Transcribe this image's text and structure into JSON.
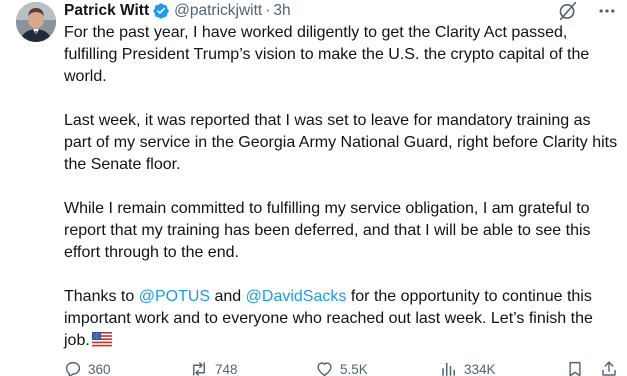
{
  "tweet": {
    "author": {
      "display_name": "Patrick Witt",
      "handle": "@patrickjwitt",
      "separator": "·",
      "time": "3h",
      "verified_color": "#1d9bf0"
    },
    "body": {
      "p1": "For the past year, I have worked diligently to get the Clarity Act passed, fulfilling President Trump’s vision to make the U.S. the crypto capital of the world.",
      "p2": "Last week, it was reported that I was set to leave for mandatory training as part of my service in the Georgia Army National Guard, right before Clarity hits the Senate floor.",
      "p3": "While I remain committed to fulfilling my service obligation, I am grateful to report that my training has been deferred, and that I will be able to see this effort through to the end.",
      "p4_prefix": "Thanks to ",
      "p4_mention1": "@POTUS",
      "p4_middle": " and ",
      "p4_mention2": "@DavidSacks",
      "p4_suffix": " for the opportunity to continue this important work and to everyone who reached out last week. Let’s finish the job."
    },
    "stats": {
      "replies": "360",
      "reposts": "748",
      "likes": "5.5K",
      "views": "334K"
    },
    "colors": {
      "text": "#0f1419",
      "secondary": "#536471",
      "link": "#1d9bf0"
    },
    "icons": [
      "verified-badge-icon",
      "grok-icon",
      "more-icon",
      "reply-icon",
      "repost-icon",
      "like-icon",
      "views-icon",
      "bookmark-icon",
      "share-icon",
      "us-flag-icon"
    ]
  }
}
